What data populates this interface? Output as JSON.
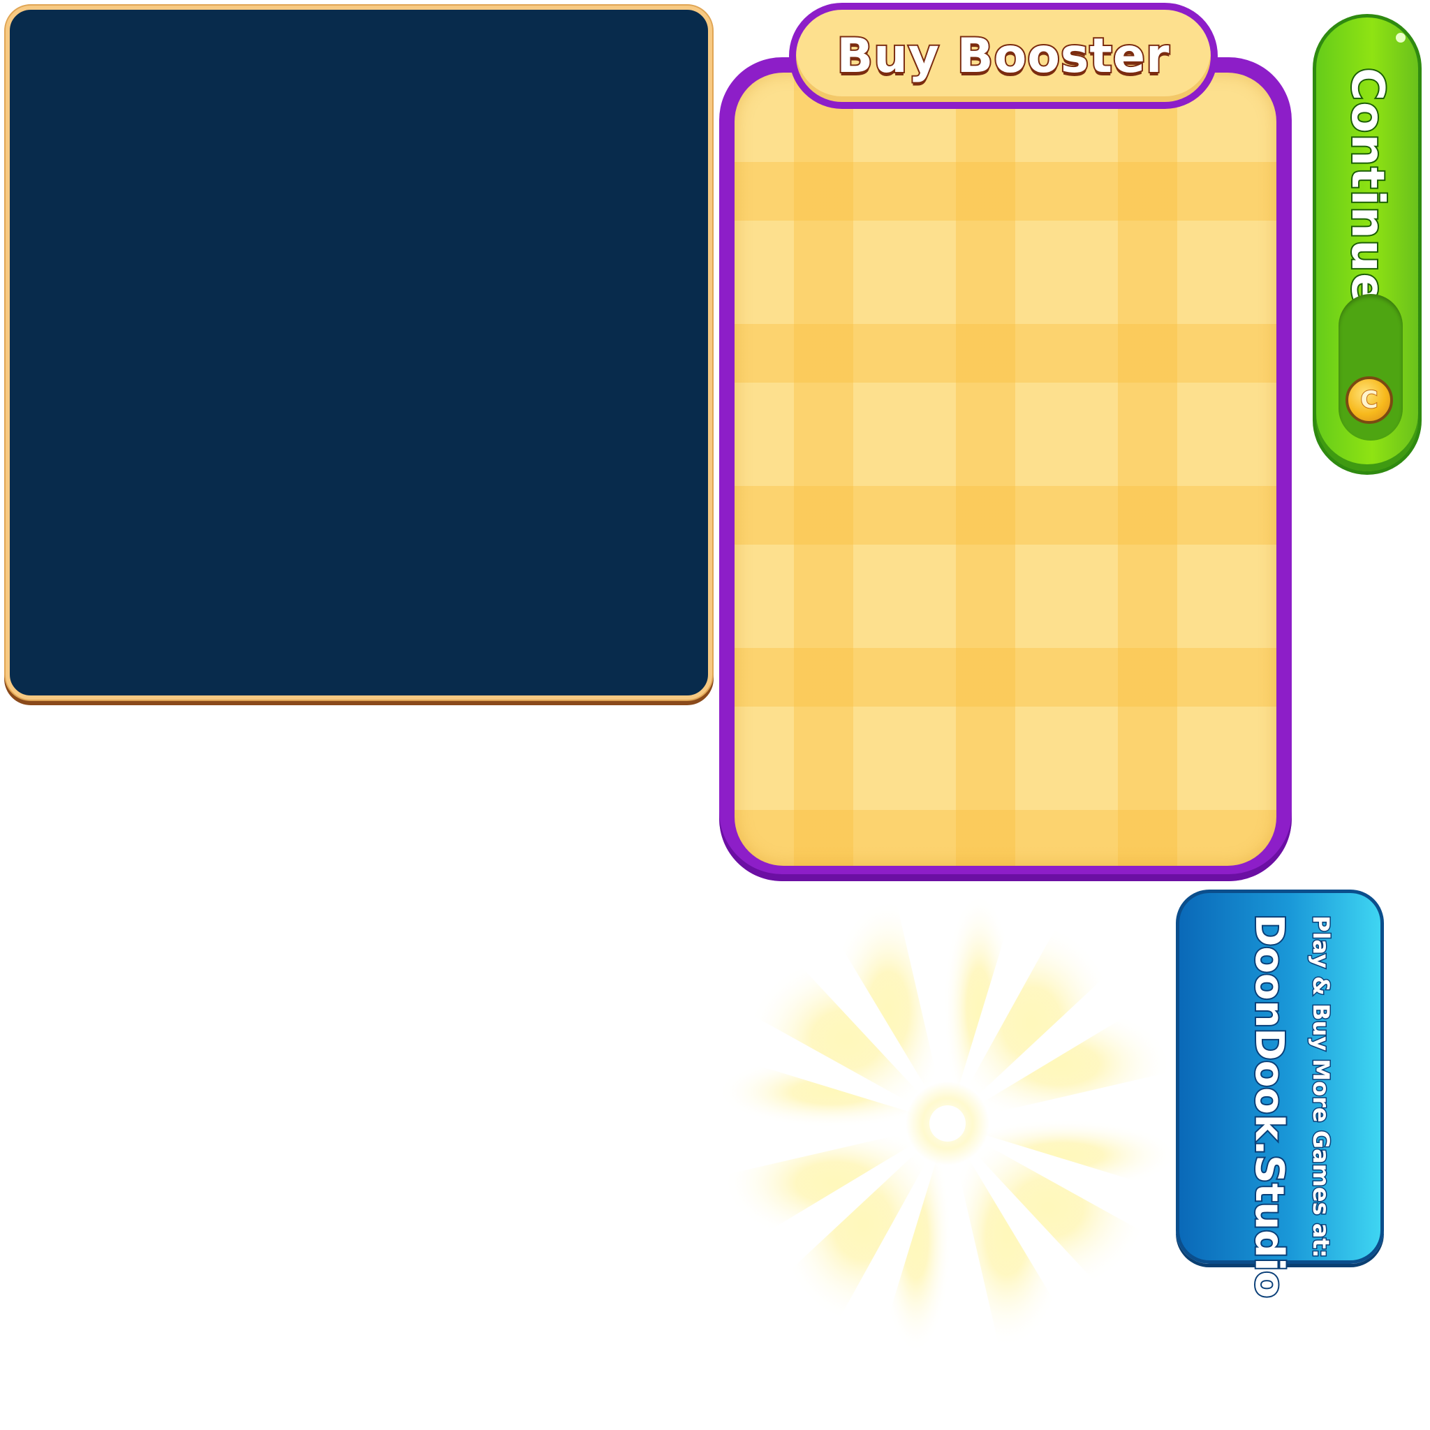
{
  "booster_panel": {
    "title": "Buy Booster"
  },
  "continue_button": {
    "label": "Continue",
    "coin_icon": "coin-icon",
    "coin_glyph": "C"
  },
  "promo_card": {
    "line1": "Play & Buy More Games at:",
    "line2": "DoonDook.Studio"
  },
  "colors": {
    "navy_panel": "#082b4c",
    "booster_border": "#8d1ec8",
    "booster_fill": "#fde08e",
    "continue_green": "#8fe313",
    "promo_blue": "#1a98d8"
  }
}
